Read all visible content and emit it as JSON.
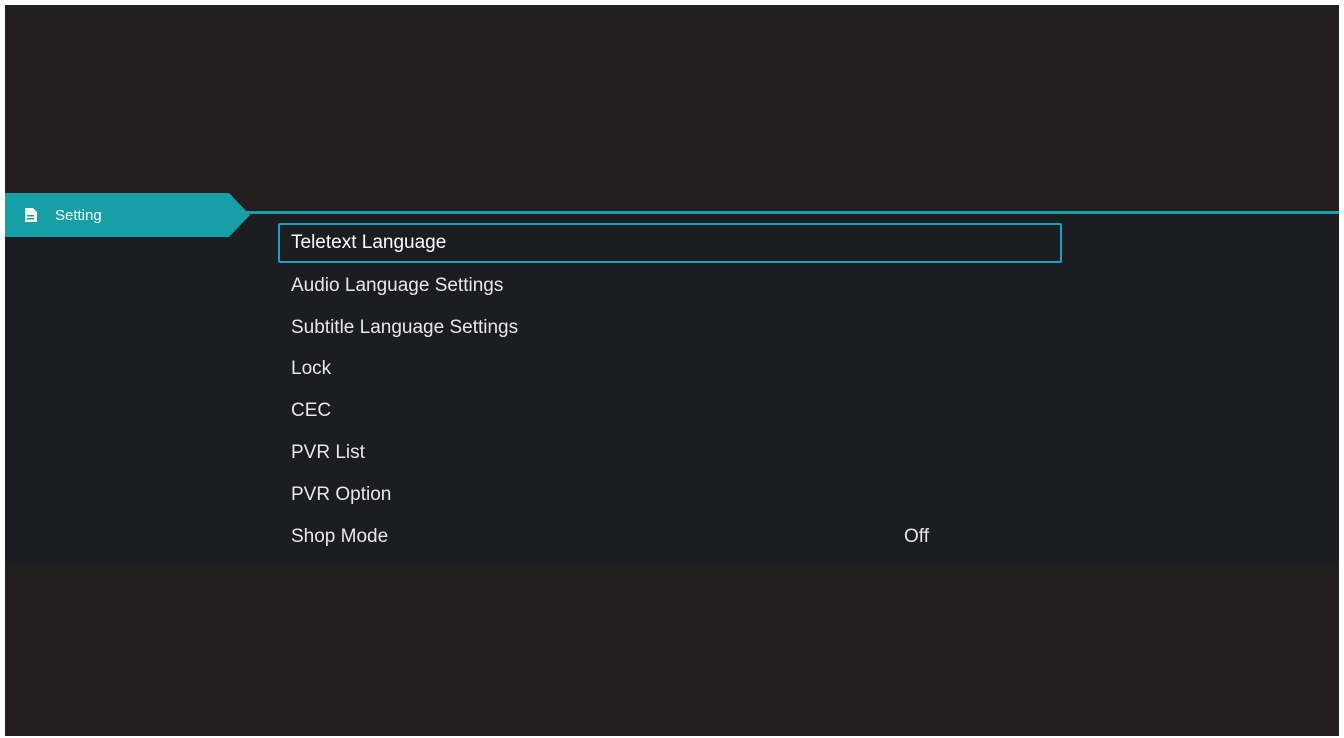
{
  "tab": {
    "label": "Setting",
    "icon": "document-icon"
  },
  "menu": {
    "items": [
      {
        "label": "Teletext Language",
        "value": "",
        "focused": true
      },
      {
        "label": "Audio Language Settings",
        "value": ""
      },
      {
        "label": "Subtitle Language Settings",
        "value": ""
      },
      {
        "label": "Lock",
        "value": ""
      },
      {
        "label": "CEC",
        "value": ""
      },
      {
        "label": "PVR List",
        "value": ""
      },
      {
        "label": "PVR Option",
        "value": ""
      },
      {
        "label": "Shop Mode",
        "value": "Off"
      }
    ]
  },
  "colors": {
    "accent": "#169fa7",
    "focus_border": "#1a9fc7",
    "background": "#231f20"
  }
}
